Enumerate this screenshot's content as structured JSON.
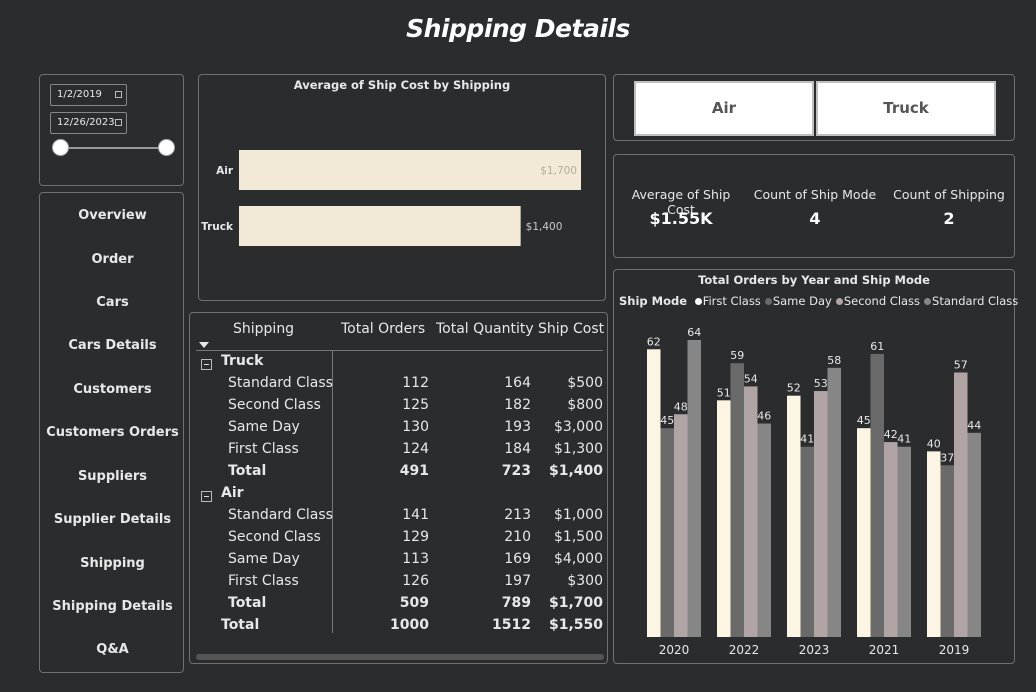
{
  "page": {
    "title": "Shipping Details"
  },
  "date_slicer": {
    "start": "1/2/2019",
    "end": "12/26/2023"
  },
  "nav": {
    "items": [
      {
        "label": "Overview"
      },
      {
        "label": "Order"
      },
      {
        "label": "Cars"
      },
      {
        "label": "Cars Details"
      },
      {
        "label": "Customers"
      },
      {
        "label": "Customers Orders"
      },
      {
        "label": "Suppliers"
      },
      {
        "label": "Supplier Details"
      },
      {
        "label": "Shipping"
      },
      {
        "label": "Shipping Details"
      },
      {
        "label": "Q&A"
      }
    ]
  },
  "bar_chart": {
    "title": "Average of Ship Cost by Shipping",
    "bar_color": "#f2ead7",
    "categories": [
      "Air",
      "Truck"
    ],
    "values": [
      1700,
      1400
    ],
    "labels": [
      "$1,700",
      "$1,400"
    ]
  },
  "table": {
    "headers": [
      "Shipping",
      "Total Orders",
      "Total Quantity",
      "Ship Cost"
    ],
    "groups": [
      {
        "name": "Truck",
        "rows": [
          {
            "name": "Standard Class",
            "orders": "112",
            "qty": "164",
            "cost": "$500"
          },
          {
            "name": "Second Class",
            "orders": "125",
            "qty": "182",
            "cost": "$800"
          },
          {
            "name": "Same Day",
            "orders": "130",
            "qty": "193",
            "cost": "$3,000"
          },
          {
            "name": "First Class",
            "orders": "124",
            "qty": "184",
            "cost": "$1,300"
          }
        ],
        "total": {
          "name": "Total",
          "orders": "491",
          "qty": "723",
          "cost": "$1,400"
        }
      },
      {
        "name": "Air",
        "rows": [
          {
            "name": "Standard Class",
            "orders": "141",
            "qty": "213",
            "cost": "$1,000"
          },
          {
            "name": "Second Class",
            "orders": "129",
            "qty": "210",
            "cost": "$1,500"
          },
          {
            "name": "Same Day",
            "orders": "113",
            "qty": "169",
            "cost": "$4,000"
          },
          {
            "name": "First Class",
            "orders": "126",
            "qty": "197",
            "cost": "$300"
          }
        ],
        "total": {
          "name": "Total",
          "orders": "509",
          "qty": "789",
          "cost": "$1,700"
        }
      }
    ],
    "grand_total": {
      "name": "Total",
      "orders": "1000",
      "qty": "1512",
      "cost": "$1,550"
    },
    "expand_icon": "minus-square-icon"
  },
  "mode_slicer": {
    "buttons": [
      "Air",
      "Truck"
    ]
  },
  "kpis": [
    {
      "label": "Average of Ship Cost",
      "value": "$1.55K"
    },
    {
      "label": "Count of Ship Mode",
      "value": "4"
    },
    {
      "label": "Count of Shipping",
      "value": "2"
    }
  ],
  "chart_data": {
    "type": "bar",
    "title": "Total Orders by Year and Ship Mode",
    "legend_title": "Ship Mode",
    "legend_position": "top-left",
    "categories": [
      "2020",
      "2022",
      "2023",
      "2021",
      "2019"
    ],
    "series": [
      {
        "name": "First Class",
        "color": "#fcf5e3",
        "values": [
          62,
          51,
          52,
          45,
          40
        ]
      },
      {
        "name": "Same Day",
        "color": "#6a6a6a",
        "values": [
          45,
          59,
          41,
          61,
          37
        ]
      },
      {
        "name": "Second Class",
        "color": "#b0a4a5",
        "values": [
          48,
          54,
          53,
          42,
          57
        ]
      },
      {
        "name": "Standard Class",
        "color": "#868686",
        "values": [
          64,
          46,
          58,
          41,
          44
        ]
      }
    ],
    "ylim": [
      0,
      64
    ],
    "grid": false
  }
}
